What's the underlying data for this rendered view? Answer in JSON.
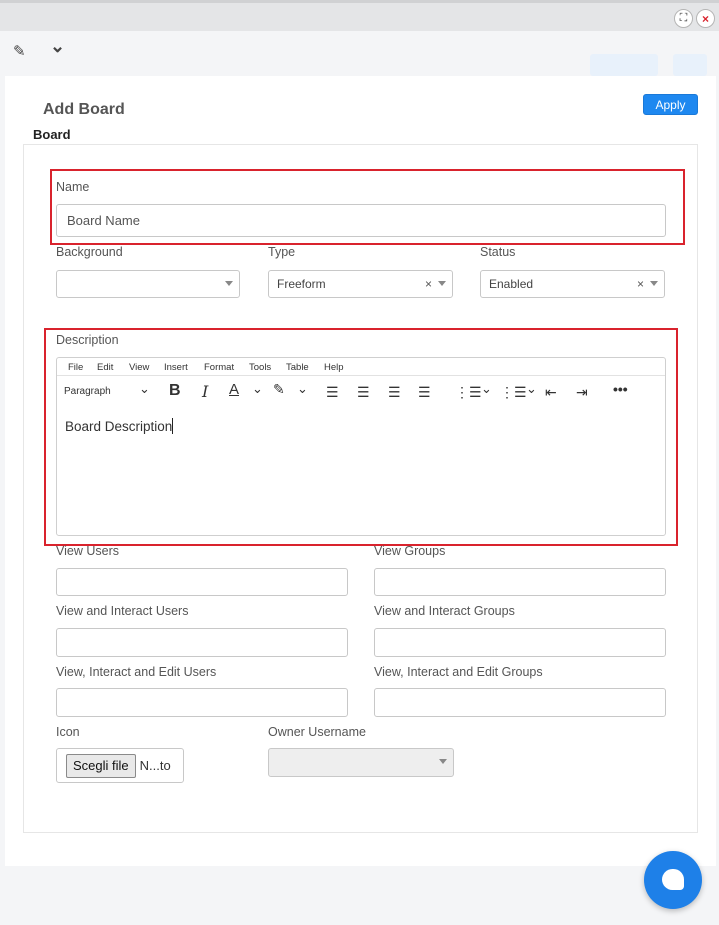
{
  "window": {
    "expand_glyph": "⛶",
    "close_glyph": "×"
  },
  "toolbar": {
    "edit_icon_glyph": "✎",
    "chevron_icon_glyph": "⌄"
  },
  "panel": {
    "title": "Add Board",
    "apply_label": "Apply",
    "section_label": "Board"
  },
  "fields": {
    "name": {
      "label": "Name",
      "placeholder": "Board Name"
    },
    "background": {
      "label": "Background",
      "value": ""
    },
    "type": {
      "label": "Type",
      "value": "Freeform"
    },
    "status": {
      "label": "Status",
      "value": "Enabled"
    },
    "description": {
      "label": "Description",
      "menu": [
        "File",
        "Edit",
        "View",
        "Insert",
        "Format",
        "Tools",
        "Table",
        "Help"
      ],
      "paragraph_label": "Paragraph",
      "content": "Board Description"
    },
    "view_users": {
      "label": "View Users"
    },
    "view_groups": {
      "label": "View Groups"
    },
    "interact_users": {
      "label": "View and Interact Users"
    },
    "interact_groups": {
      "label": "View and Interact Groups"
    },
    "edit_users": {
      "label": "View, Interact and Edit Users"
    },
    "edit_groups": {
      "label": "View, Interact and Edit Groups"
    },
    "icon": {
      "label": "Icon",
      "button": "Scegli file",
      "filename": "N...to"
    },
    "owner": {
      "label": "Owner Username"
    }
  },
  "colors": {
    "accent": "#1e88f0",
    "highlight": "#d9232d"
  }
}
